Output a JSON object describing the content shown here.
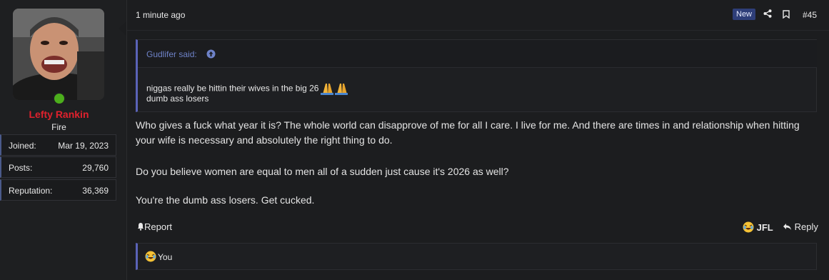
{
  "user": {
    "name": "Lefty Rankin",
    "title": "Fire",
    "stats": [
      {
        "label": "Joined:",
        "value": "Mar 19, 2023"
      },
      {
        "label": "Posts:",
        "value": "29,760"
      },
      {
        "label": "Reputation:",
        "value": "36,369"
      }
    ]
  },
  "post": {
    "time": "1 minute ago",
    "badge": "New",
    "number": "#45",
    "quote": {
      "author": "Gudlifer said:",
      "line1": "niggas really be hittin their wives in the big 26",
      "line2": "dumb ass losers"
    },
    "paragraphs": [
      "Who gives a fuck what year it is? The whole world can disapprove of me for all I care. I live for me. And there are times in and relationship when hitting your wife is necessary and absolutely the right thing to do.",
      "Do you believe women are equal to men all of a sudden just cause it's 2026 as well?",
      "You're the dumb ass losers. Get cucked."
    ],
    "actions": {
      "report": "Report",
      "jfl": "JFL",
      "reply": "Reply"
    },
    "reactions": {
      "text": "You"
    }
  },
  "colors": {
    "username": "#e0212d",
    "accent": "#5a63b8",
    "online": "#4cae1c"
  }
}
